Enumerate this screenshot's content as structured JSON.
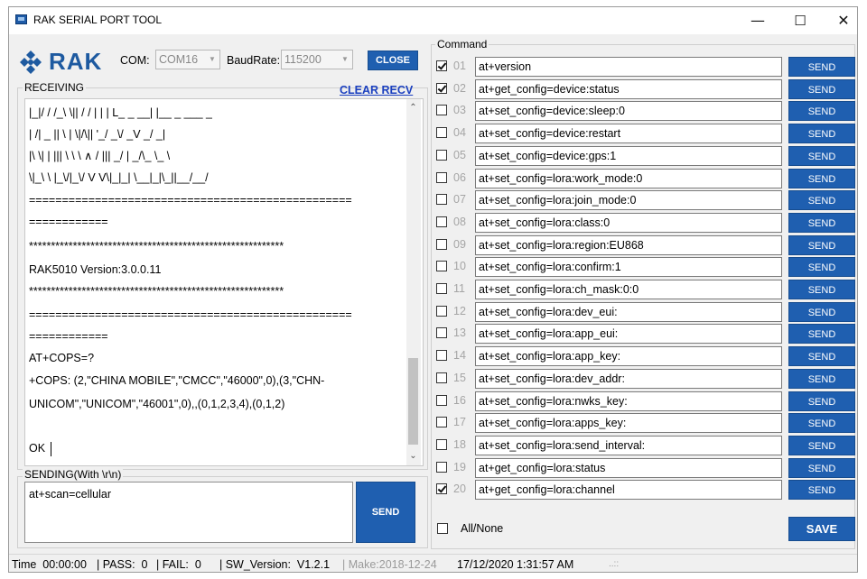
{
  "window": {
    "title": "RAK SERIAL PORT TOOL",
    "minimize": "—",
    "maximize": "☐",
    "close": "✕"
  },
  "logo": {
    "text": "RAK"
  },
  "connection": {
    "com_label": "COM:",
    "com_value": "COM16",
    "baud_label": "BaudRate:",
    "baud_value": "115200",
    "close_label": "CLOSE"
  },
  "receiving": {
    "title": "RECEIVING",
    "clear_label": "CLEAR RECV",
    "lines": [
      "|_|/ / /_\\ \\|| / / | | | L_ _ __| |__ _ ___ _",
      "| /| _ || \\ | \\|/\\|| '_/ _\\/ _V _/ _|",
      "|\\ \\| | ||| \\ \\ \\ ∧ / ||| _/ | _/\\_ \\_ \\",
      "\\|_\\ \\ |_\\/|_\\/ V V\\|_|_| \\__|_|\\_||__/__/",
      "=================================================",
      "============",
      "**********************************************************",
      "RAK5010 Version:3.0.0.11",
      "**********************************************************",
      "=================================================",
      "============",
      "AT+COPS=?",
      "+COPS: (2,\"CHINA MOBILE\",\"CMCC\",\"46000\",0),(3,\"CHN-",
      "UNICOM\",\"UNICOM\",\"46001\",0),,(0,1,2,3,4),(0,1,2)",
      "",
      "OK"
    ]
  },
  "sending": {
    "title": "SENDING(With \\r\\n)",
    "value": "at+scan=cellular",
    "send_label": "SEND"
  },
  "command": {
    "title": "Command",
    "send_label": "SEND",
    "rows": [
      {
        "num": "01",
        "checked": true,
        "cmd": "at+version"
      },
      {
        "num": "02",
        "checked": true,
        "cmd": "at+get_config=device:status"
      },
      {
        "num": "03",
        "checked": false,
        "cmd": "at+set_config=device:sleep:0"
      },
      {
        "num": "04",
        "checked": false,
        "cmd": "at+set_config=device:restart"
      },
      {
        "num": "05",
        "checked": false,
        "cmd": "at+set_config=device:gps:1"
      },
      {
        "num": "06",
        "checked": false,
        "cmd": "at+set_config=lora:work_mode:0"
      },
      {
        "num": "07",
        "checked": false,
        "cmd": "at+set_config=lora:join_mode:0"
      },
      {
        "num": "08",
        "checked": false,
        "cmd": "at+set_config=lora:class:0"
      },
      {
        "num": "09",
        "checked": false,
        "cmd": "at+set_config=lora:region:EU868"
      },
      {
        "num": "10",
        "checked": false,
        "cmd": "at+set_config=lora:confirm:1"
      },
      {
        "num": "11",
        "checked": false,
        "cmd": "at+set_config=lora:ch_mask:0:0"
      },
      {
        "num": "12",
        "checked": false,
        "cmd": "at+set_config=lora:dev_eui:"
      },
      {
        "num": "13",
        "checked": false,
        "cmd": "at+set_config=lora:app_eui:"
      },
      {
        "num": "14",
        "checked": false,
        "cmd": "at+set_config=lora:app_key:"
      },
      {
        "num": "15",
        "checked": false,
        "cmd": "at+set_config=lora:dev_addr:"
      },
      {
        "num": "16",
        "checked": false,
        "cmd": "at+set_config=lora:nwks_key:"
      },
      {
        "num": "17",
        "checked": false,
        "cmd": "at+set_config=lora:apps_key:"
      },
      {
        "num": "18",
        "checked": false,
        "cmd": "at+set_config=lora:send_interval:"
      },
      {
        "num": "19",
        "checked": false,
        "cmd": "at+get_config=lora:status"
      },
      {
        "num": "20",
        "checked": true,
        "cmd": "at+get_config=lora:channel"
      }
    ],
    "all_none_label": "All/None",
    "save_label": "SAVE"
  },
  "status": {
    "time": "Time  00:00:00",
    "pass": "| PASS:  0",
    "fail": "| FAIL:  0",
    "version": "| SW_Version:  V1.2.1",
    "make": "| Make:2018-12-24",
    "datetime": "17/12/2020 1:31:57 AM",
    "grip": "..::"
  },
  "colors": {
    "accent": "#1f5fb0",
    "link": "#1a3fbf",
    "logo": "#1e5aa0"
  }
}
